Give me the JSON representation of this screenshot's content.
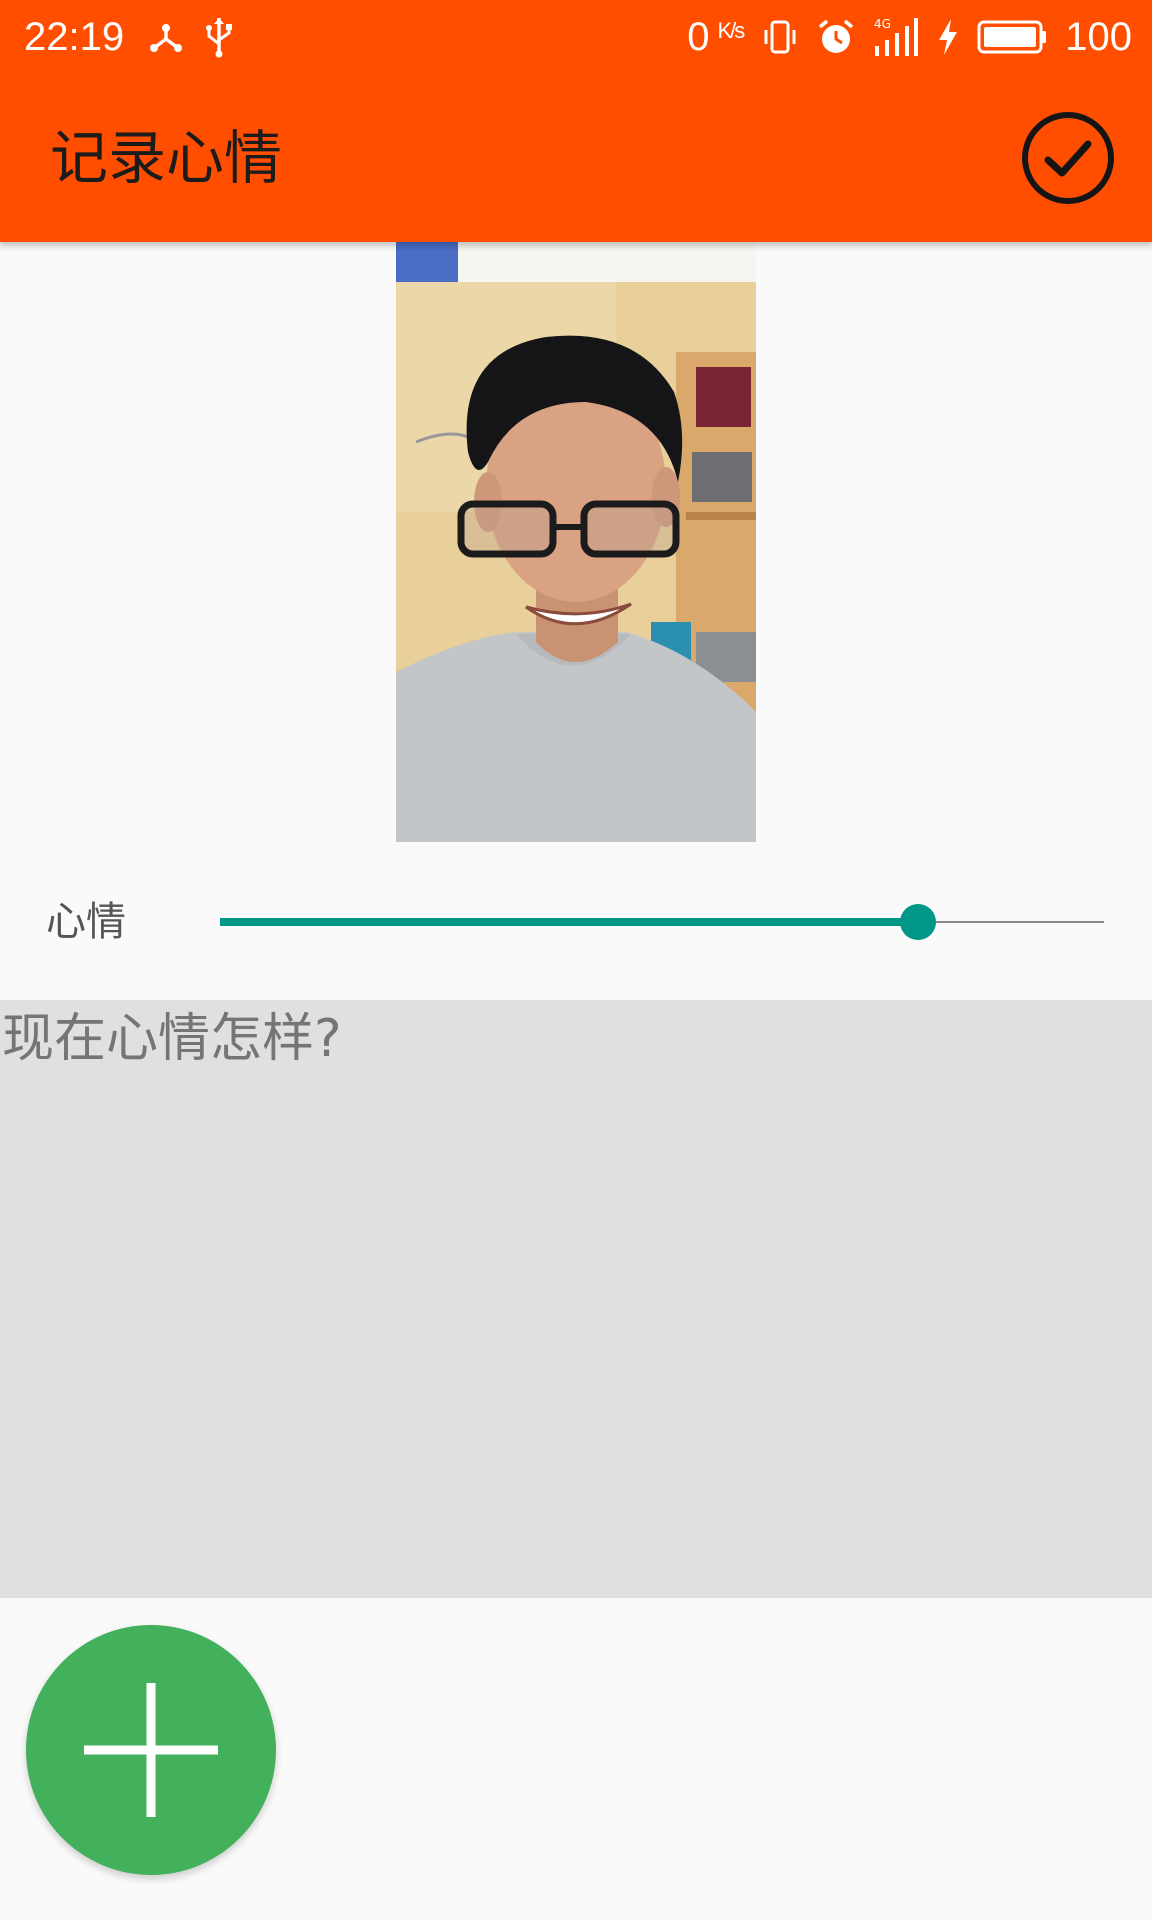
{
  "status_bar": {
    "time": "22:19",
    "left_icons": [
      "share-icon",
      "usb-icon"
    ],
    "net_speed_value": "0",
    "net_speed_unit": "K/s",
    "right_icons": [
      "vibrate-icon",
      "alarm-icon",
      "signal-4g-icon",
      "charging-icon",
      "battery-icon"
    ],
    "network_type": "4G",
    "battery_level": "100"
  },
  "app_bar": {
    "title": "记录心情",
    "confirm_icon": "check-circle-icon",
    "background": "#ff4e00"
  },
  "photo": {
    "description": "selfie-photo"
  },
  "mood": {
    "label": "心情",
    "slider_value": 0.79,
    "accent": "#009688"
  },
  "note": {
    "placeholder": "现在心情怎样?",
    "value": ""
  },
  "fab": {
    "icon": "plus-icon",
    "color": "#43b05c"
  }
}
